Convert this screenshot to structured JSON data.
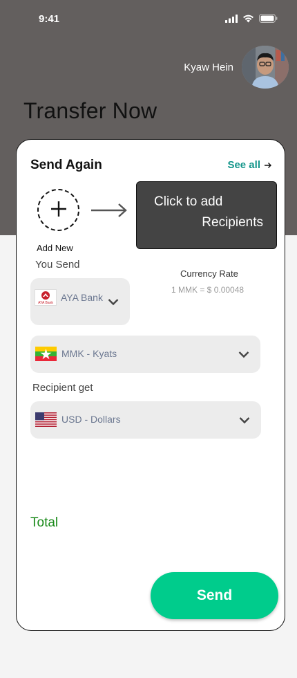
{
  "status_bar": {
    "time": "9:41",
    "icons": [
      "signal-icon",
      "wifi-icon",
      "battery-icon"
    ]
  },
  "profile": {
    "name": "Kyaw Hein",
    "avatar": "avatar"
  },
  "page": {
    "title": "Transfer Now"
  },
  "send_again": {
    "title": "Send Again",
    "see_all": "See all",
    "see_all_icon": "arrow-right-icon",
    "add_new": "Add New",
    "add_icon": "plus-icon"
  },
  "tooltip": {
    "line1": "Click to add",
    "line2": "Recipients"
  },
  "you_send": {
    "label": "You Send",
    "bank": {
      "name": "AYA Bank",
      "logo_text": "AYA Bank"
    },
    "currency": {
      "label": "MMK - Kyats",
      "flag": "myanmar-flag-icon"
    }
  },
  "rate": {
    "label": "Currency Rate",
    "value": "1 MMK = $ 0.00048"
  },
  "recipient_get": {
    "label": "Recipient get",
    "currency": {
      "label": "USD -  Dollars",
      "flag": "us-flag-icon"
    }
  },
  "total": {
    "label": "Total"
  },
  "actions": {
    "send_label": "Send"
  },
  "colors": {
    "header_bg": "#635f5e",
    "accent_teal": "#12958a",
    "send_button": "#00cc8c",
    "total_text": "#1a8a1a",
    "tooltip_bg": "#444444"
  }
}
